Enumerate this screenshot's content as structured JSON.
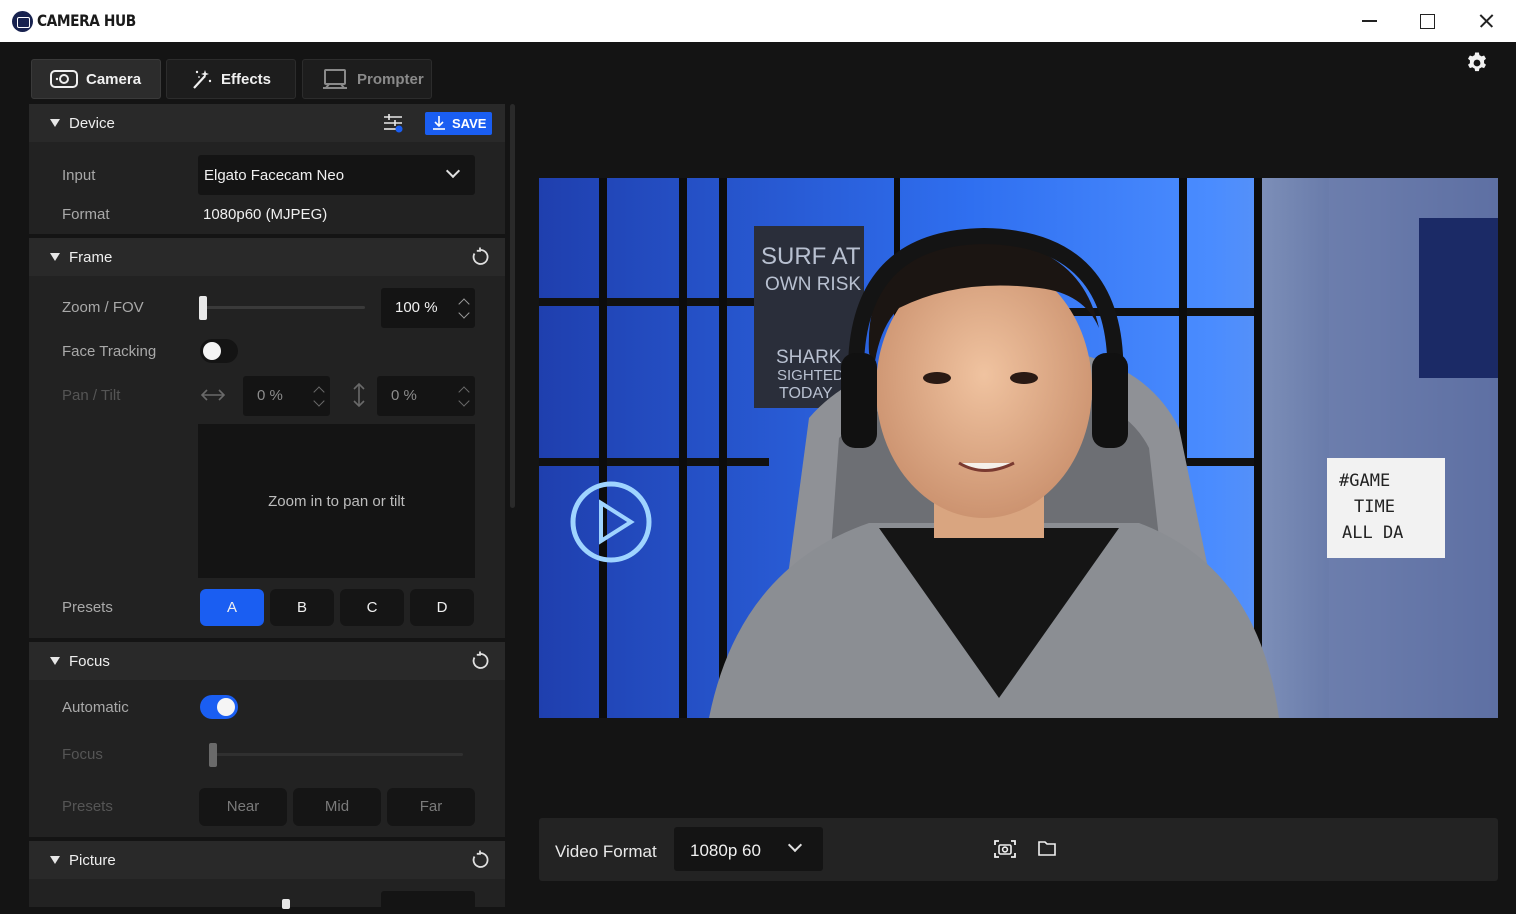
{
  "app": {
    "title": "CAMERA HUB",
    "icons": {
      "logo": "camera-logo-icon",
      "minimize": "minimize-icon",
      "maximize": "maximize-icon",
      "close": "close-icon"
    }
  },
  "tabs": [
    {
      "label": "Camera",
      "icon": "camera-icon",
      "active": true
    },
    {
      "label": "Effects",
      "icon": "magic-wand-icon",
      "active": false
    },
    {
      "label": "Prompter",
      "icon": "prompter-icon",
      "active": false
    }
  ],
  "settings_icon": "gear-icon",
  "device": {
    "title": "Device",
    "save_label": "SAVE",
    "input_label": "Input",
    "input_value": "Elgato Facecam Neo",
    "format_label": "Format",
    "format_value": "1080p60 (MJPEG)"
  },
  "frame": {
    "title": "Frame",
    "zoom_label": "Zoom / FOV",
    "zoom_value": "100 %",
    "zoom_level": 0,
    "face_tracking_label": "Face Tracking",
    "face_tracking_on": false,
    "pan_tilt_label": "Pan / Tilt",
    "pan_value": "0 %",
    "tilt_value": "0 %",
    "pan_area_text": "Zoom in to pan or tilt",
    "presets_label": "Presets",
    "presets": [
      "A",
      "B",
      "C",
      "D"
    ],
    "active_preset": "A"
  },
  "focus": {
    "title": "Focus",
    "automatic_label": "Automatic",
    "automatic_on": true,
    "focus_label": "Focus",
    "presets_label": "Presets",
    "presets": [
      "Near",
      "Mid",
      "Far"
    ]
  },
  "picture": {
    "title": "Picture"
  },
  "bottom_bar": {
    "video_format_label": "Video Format",
    "video_format_value": "1080p 60",
    "snapshot_icon": "camera-snapshot-icon",
    "folder_icon": "folder-icon"
  },
  "colors": {
    "accent": "#1a5ef2",
    "background": "#141414",
    "panel": "#222222",
    "section_header": "#292929"
  }
}
